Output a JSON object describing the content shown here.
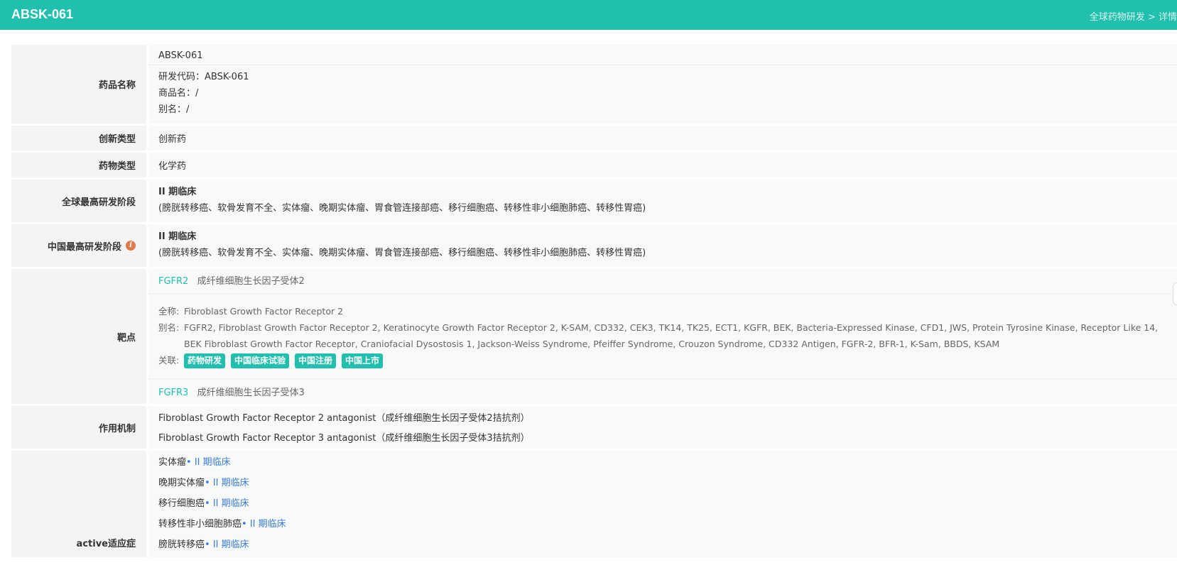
{
  "header": {
    "title": "ABSK-061",
    "breadcrumb_parent": "全球药物研发",
    "breadcrumb_sep": " > ",
    "breadcrumb_current": "详情"
  },
  "labels": {
    "drug_name": "药品名称",
    "innovation_type": "创新类型",
    "drug_type": "药物类型",
    "global_stage": "全球最高研发阶段",
    "china_stage": "中国最高研发阶段",
    "target": "靶点",
    "mechanism": "作用机制",
    "active_indications": "active适应症"
  },
  "drug_name": {
    "name": "ABSK-061",
    "rd_code": "研发代码：ABSK-061",
    "trade_name": "商品名：/",
    "alias": "别名：/"
  },
  "innovation_type": "创新药",
  "drug_type": "化学药",
  "global_stage": {
    "phase": "II 期临床",
    "indications": "(膀胱转移癌、软骨发育不全、实体瘤、晚期实体瘤、胃食管连接部癌、移行细胞癌、转移性非小细胞肺癌、转移性胃癌)"
  },
  "china_stage": {
    "phase": "II 期临床",
    "indications": "(膀胱转移癌、软骨发育不全、实体瘤、晚期实体瘤、胃食管连接部癌、移行细胞癌、转移性非小细胞肺癌、转移性胃癌)"
  },
  "targets": {
    "fgfr2_code": "FGFR2",
    "fgfr2_name": "成纤维细胞生长因子受体2",
    "fullname_key": "全称:",
    "fullname_value": "Fibroblast Growth Factor Receptor 2",
    "alias_key": "别名:",
    "alias_value": "FGFR2, Fibroblast Growth Factor Receptor 2, Keratinocyte Growth Factor Receptor 2, K-SAM, CD332, CEK3, TK14, TK25, ECT1, KGFR, BEK, Bacteria-Expressed Kinase, CFD1, JWS, Protein Tyrosine Kinase, Receptor Like 14, BEK Fibroblast Growth Factor Receptor, Craniofacial Dysostosis 1, Jackson-Weiss Syndrome, Pfeiffer Syndrome, Crouzon Syndrome, CD332 Antigen, FGFR-2, BFR-1, K-Sam, BBDS, KSAM",
    "related_key": "关联:",
    "tags": [
      "药物研发",
      "中国临床试验",
      "中国注册",
      "中国上市"
    ],
    "fgfr3_code": "FGFR3",
    "fgfr3_name": "成纤维细胞生长因子受体3"
  },
  "mechanism": {
    "line1": "Fibroblast Growth Factor Receptor 2 antagonist（成纤维细胞生长因子受体2拮抗剂）",
    "line2": "Fibroblast Growth Factor Receptor 3 antagonist（成纤维细胞生长因子受体3拮抗剂）"
  },
  "active_indications": [
    {
      "name": "实体瘤",
      "phase": "• II 期临床"
    },
    {
      "name": "晚期实体瘤",
      "phase": "• II 期临床"
    },
    {
      "name": "移行细胞癌",
      "phase": "• II 期临床"
    },
    {
      "name": "转移性非小细胞肺癌",
      "phase": "• II 期临床"
    },
    {
      "name": "膀胱转移癌",
      "phase": "• II 期临床"
    }
  ],
  "colors": {
    "brand": "#20bfae",
    "phase_link": "#3a7bd5",
    "info_icon": "#e07a4b"
  }
}
